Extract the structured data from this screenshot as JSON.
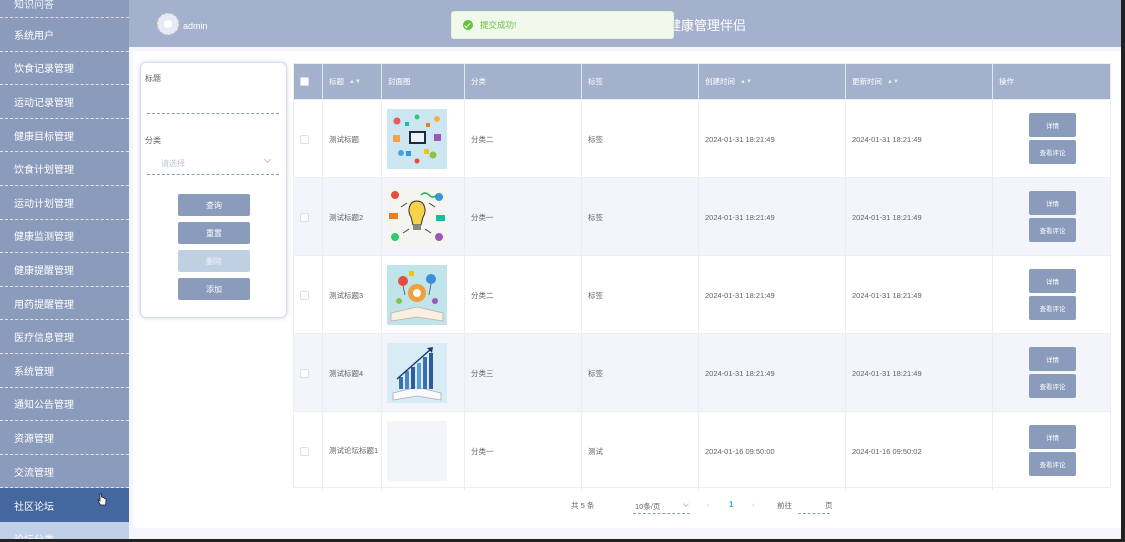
{
  "sidebar": {
    "partial_top": "知识问答",
    "items": [
      "系统用户",
      "饮食记录管理",
      "运动记录管理",
      "健康目标管理",
      "饮食计划管理",
      "运动计划管理",
      "健康监测管理",
      "健康提醒管理",
      "用药提醒管理",
      "医疗信息管理",
      "系统管理",
      "通知公告管理",
      "资源管理",
      "交流管理"
    ],
    "active": "社区论坛",
    "sub": "论坛分类"
  },
  "header": {
    "username": "admin",
    "system_title": "健康管理伴侣"
  },
  "toast": {
    "message": "提交成功!"
  },
  "search": {
    "title_label": "标题",
    "category_label": "分类",
    "category_placeholder": "请选择",
    "btn_query": "查询",
    "btn_reset": "重置",
    "btn_delete": "删除",
    "btn_add": "添加"
  },
  "table": {
    "headers": [
      "标题",
      "封面图",
      "分类",
      "标签",
      "创建时间",
      "更新时间",
      "操作"
    ],
    "rows": [
      {
        "title": "测试标题",
        "category": "分类二",
        "tag": "标签",
        "created": "2024-01-31 18:21:49",
        "updated": "2024-01-31 18:21:49",
        "btn_detail": "详情",
        "btn_comment": "查看评论"
      },
      {
        "title": "测试标题2",
        "category": "分类一",
        "tag": "标签",
        "created": "2024-01-31 18:21:49",
        "updated": "2024-01-31 18:21:49",
        "btn_detail": "详情",
        "btn_comment": "查看评论"
      },
      {
        "title": "测试标题3",
        "category": "分类二",
        "tag": "标签",
        "created": "2024-01-31 18:21:49",
        "updated": "2024-01-31 18:21:49",
        "btn_detail": "详情",
        "btn_comment": "查看评论"
      },
      {
        "title": "测试标题4",
        "category": "分类三",
        "tag": "标签",
        "created": "2024-01-31 18:21:49",
        "updated": "2024-01-31 18:21:49",
        "btn_detail": "详情",
        "btn_comment": "查看评论"
      },
      {
        "title": "测试论坛标题1",
        "category": "分类一",
        "tag": "测试",
        "created": "2024-01-16 09:50:00",
        "updated": "2024-01-16 09:50:02",
        "btn_detail": "详情",
        "btn_comment": "查看评论"
      }
    ]
  },
  "pager": {
    "total": "共 5 条",
    "page_size": "10条/页",
    "current": "1",
    "goto": "前往",
    "page_unit": "页"
  }
}
